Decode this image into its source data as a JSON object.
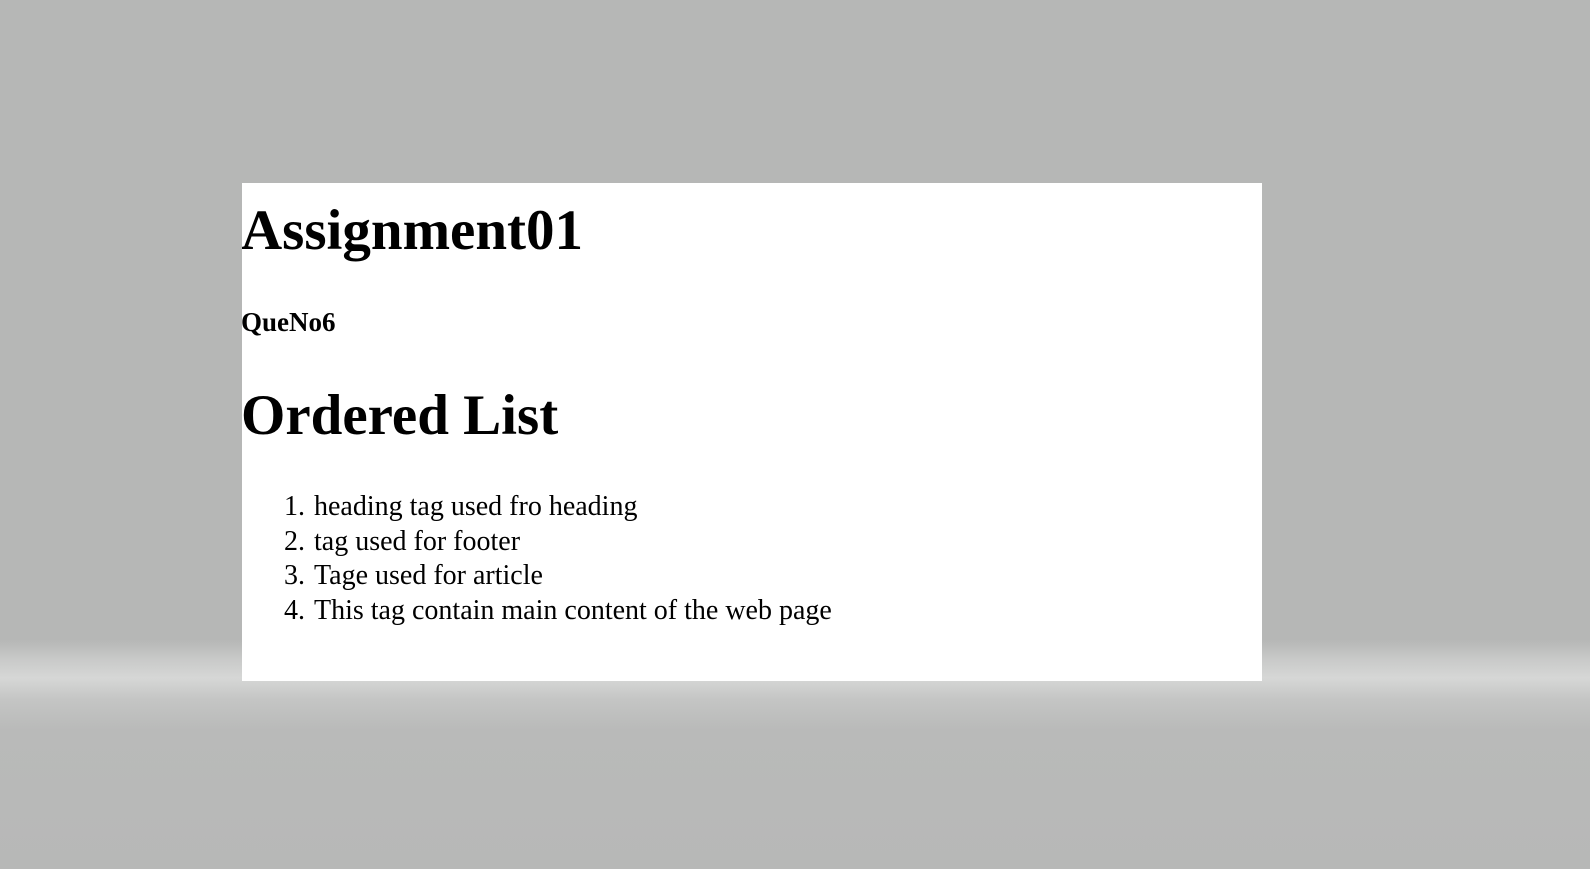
{
  "page": {
    "title": "Assignment01",
    "subtitle": "QueNo6",
    "section_heading": "Ordered List",
    "ordered_list": [
      {
        "number": "1.",
        "text": "heading tag used fro heading"
      },
      {
        "number": "2.",
        "text": "tag used for footer"
      },
      {
        "number": "3.",
        "text": "Tage used for article"
      },
      {
        "number": "4.",
        "text": "This tag contain main content of the web page"
      }
    ]
  }
}
